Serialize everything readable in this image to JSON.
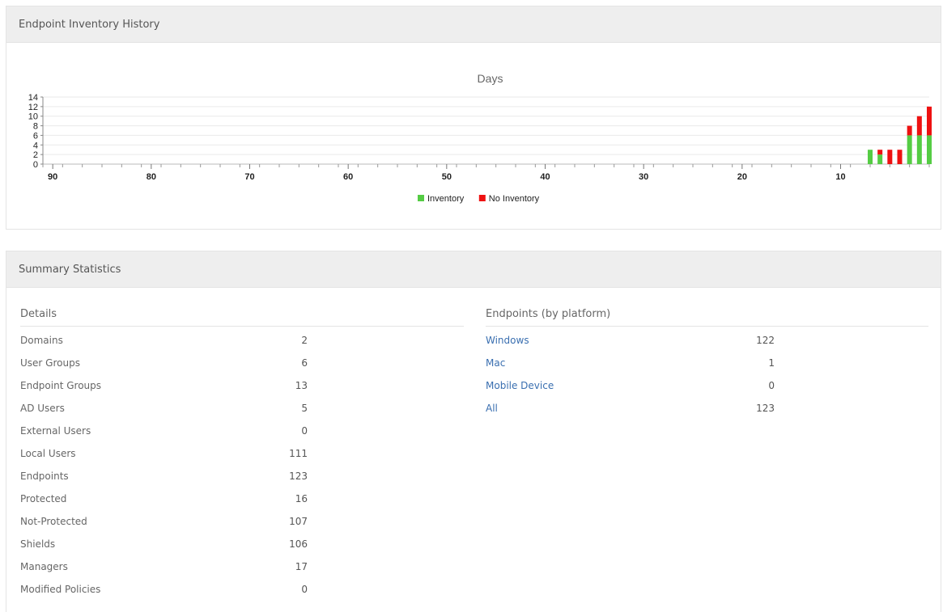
{
  "history_panel": {
    "title": "Endpoint Inventory History"
  },
  "summary_panel": {
    "title": "Summary Statistics"
  },
  "details": {
    "title": "Details",
    "rows": [
      {
        "label": "Domains",
        "value": "2"
      },
      {
        "label": "User Groups",
        "value": "6"
      },
      {
        "label": "Endpoint Groups",
        "value": "13"
      },
      {
        "label": "AD Users",
        "value": "5"
      },
      {
        "label": "External Users",
        "value": "0"
      },
      {
        "label": "Local Users",
        "value": "111"
      },
      {
        "label": "Endpoints",
        "value": "123"
      },
      {
        "label": "Protected",
        "value": "16"
      },
      {
        "label": "Not-Protected",
        "value": "107"
      },
      {
        "label": "Shields",
        "value": "106"
      },
      {
        "label": "Managers",
        "value": "17"
      },
      {
        "label": "Modified Policies",
        "value": "0"
      }
    ]
  },
  "platforms": {
    "title": "Endpoints (by platform)",
    "rows": [
      {
        "label": "Windows",
        "value": "122"
      },
      {
        "label": "Mac",
        "value": "1"
      },
      {
        "label": "Mobile Device",
        "value": "0"
      },
      {
        "label": "All",
        "value": "123"
      }
    ]
  },
  "chart_data": {
    "type": "bar",
    "title": "Days",
    "x_reversed": true,
    "xlim": [
      91,
      1
    ],
    "ylim": [
      0,
      14
    ],
    "x_ticks": [
      90,
      80,
      70,
      60,
      50,
      40,
      30,
      20,
      10
    ],
    "y_ticks": [
      0,
      2,
      4,
      6,
      8,
      10,
      12,
      14
    ],
    "grid": true,
    "legend_position": "bottom",
    "x": [
      7,
      6,
      5,
      4,
      3,
      2,
      1
    ],
    "series": [
      {
        "name": "Inventory",
        "color": "#55cc44",
        "values": [
          3,
          2,
          0,
          0,
          6,
          6,
          6
        ]
      },
      {
        "name": "No Inventory",
        "color": "#ee1111",
        "values": [
          0,
          1,
          3,
          3,
          2,
          4,
          6
        ]
      }
    ]
  }
}
